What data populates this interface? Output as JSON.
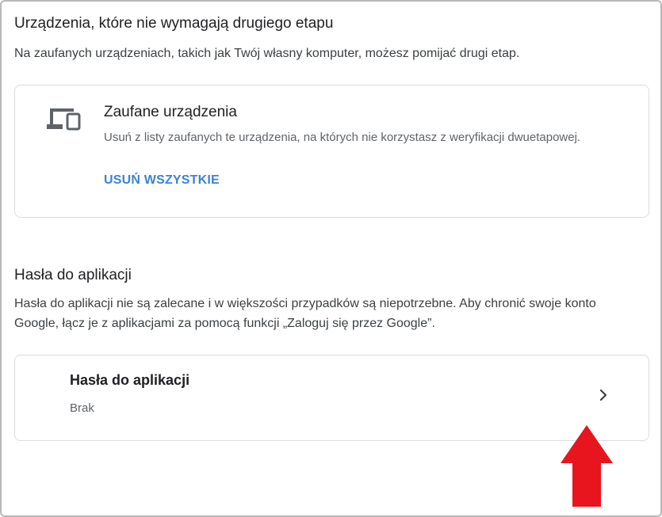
{
  "trusted_section": {
    "title": "Urządzenia, które nie wymagają drugiego etapu",
    "description": "Na zaufanych urządzeniach, takich jak Twój własny komputer, możesz pomijać drugi etap.",
    "card": {
      "icon": "devices-icon",
      "title": "Zaufane urządzenia",
      "subtitle": "Usuń z listy zaufanych te urządzenia, na których nie korzystasz z weryfikacji dwuetapowej.",
      "action_label": "USUŃ WSZYSTKIE"
    }
  },
  "app_passwords_section": {
    "title": "Hasła do aplikacji",
    "description": "Hasła do aplikacji nie są zalecane i w większości przypadków są niepotrzebne. Aby chronić swoje konto Google, łącz je z aplikacjami za pomocą funkcji „Zaloguj się przez Google”.",
    "card": {
      "title": "Hasła do aplikacji",
      "subtitle": "Brak",
      "icon": "chevron-right-icon"
    }
  },
  "annotation": {
    "icon": "red-arrow-up-icon",
    "color": "#e8141e"
  }
}
